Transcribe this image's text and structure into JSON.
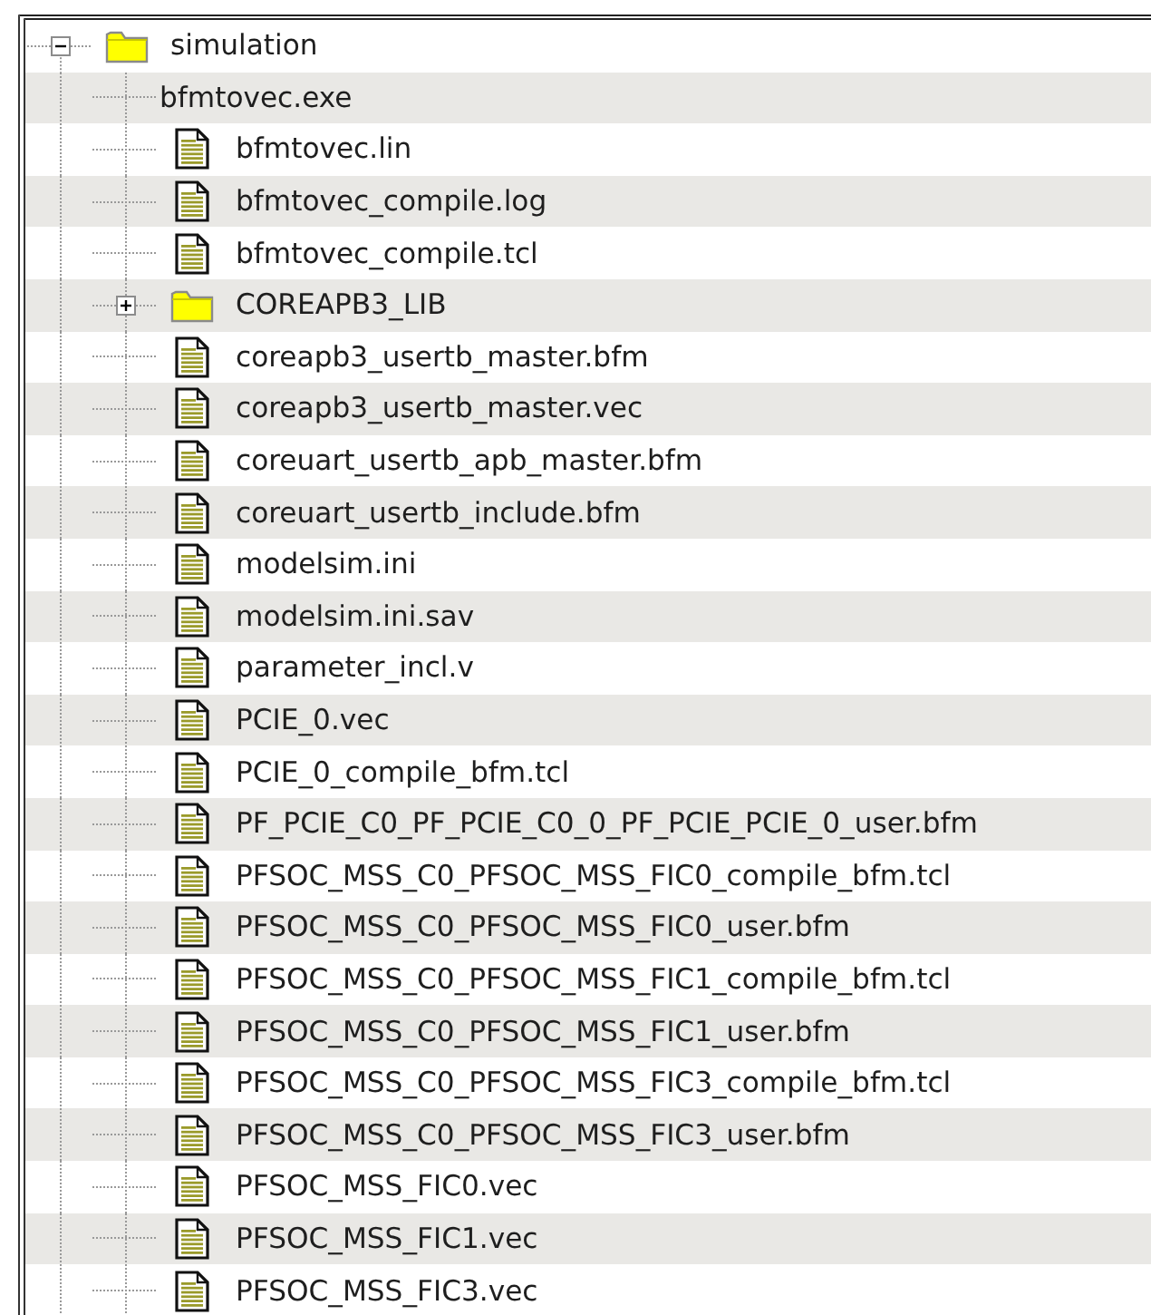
{
  "tree": {
    "items": [
      {
        "label": "simulation",
        "kind": "folder",
        "expanded": true,
        "children": [
          {
            "label": "bfmtovec.exe",
            "kind": "plain"
          },
          {
            "label": "bfmtovec.lin",
            "kind": "file"
          },
          {
            "label": "bfmtovec_compile.log",
            "kind": "file"
          },
          {
            "label": "bfmtovec_compile.tcl",
            "kind": "file"
          },
          {
            "label": "COREAPB3_LIB",
            "kind": "folder",
            "expanded": false
          },
          {
            "label": "coreapb3_usertb_master.bfm",
            "kind": "file"
          },
          {
            "label": "coreapb3_usertb_master.vec",
            "kind": "file"
          },
          {
            "label": "coreuart_usertb_apb_master.bfm",
            "kind": "file"
          },
          {
            "label": "coreuart_usertb_include.bfm",
            "kind": "file"
          },
          {
            "label": "modelsim.ini",
            "kind": "file"
          },
          {
            "label": "modelsim.ini.sav",
            "kind": "file"
          },
          {
            "label": "parameter_incl.v",
            "kind": "file"
          },
          {
            "label": "PCIE_0.vec",
            "kind": "file"
          },
          {
            "label": "PCIE_0_compile_bfm.tcl",
            "kind": "file"
          },
          {
            "label": "PF_PCIE_C0_PF_PCIE_C0_0_PF_PCIE_PCIE_0_user.bfm",
            "kind": "file"
          },
          {
            "label": "PFSOC_MSS_C0_PFSOC_MSS_FIC0_compile_bfm.tcl",
            "kind": "file"
          },
          {
            "label": "PFSOC_MSS_C0_PFSOC_MSS_FIC0_user.bfm",
            "kind": "file"
          },
          {
            "label": "PFSOC_MSS_C0_PFSOC_MSS_FIC1_compile_bfm.tcl",
            "kind": "file"
          },
          {
            "label": "PFSOC_MSS_C0_PFSOC_MSS_FIC1_user.bfm",
            "kind": "file"
          },
          {
            "label": "PFSOC_MSS_C0_PFSOC_MSS_FIC3_compile_bfm.tcl",
            "kind": "file"
          },
          {
            "label": "PFSOC_MSS_C0_PFSOC_MSS_FIC3_user.bfm",
            "kind": "file"
          },
          {
            "label": "PFSOC_MSS_FIC0.vec",
            "kind": "file"
          },
          {
            "label": "PFSOC_MSS_FIC1.vec",
            "kind": "file"
          },
          {
            "label": "PFSOC_MSS_FIC3.vec",
            "kind": "file"
          }
        ]
      }
    ]
  }
}
